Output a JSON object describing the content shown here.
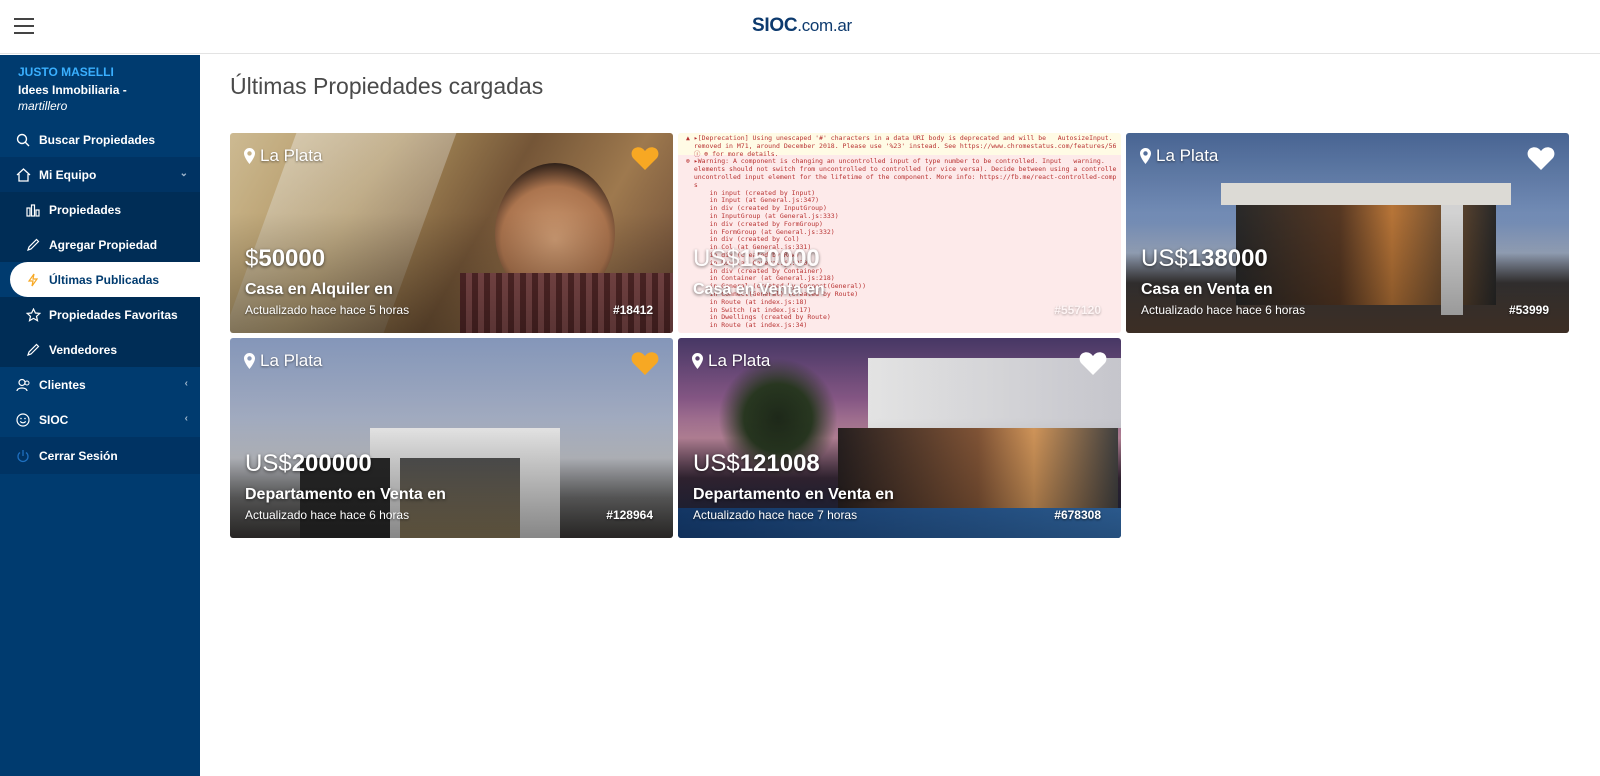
{
  "header": {
    "logo_bold": "SIOC",
    "logo_rest": ".com.ar"
  },
  "sidebar": {
    "user_name": "JUSTO MASELLI",
    "user_org": "Idees Inmobiliaria -",
    "user_role": "martillero",
    "items": [
      {
        "label": "Buscar Propiedades",
        "icon": "search-icon"
      },
      {
        "label": "Mi Equipo",
        "icon": "home-icon"
      },
      {
        "label": "Propiedades",
        "icon": "bar-chart-icon"
      },
      {
        "label": "Agregar Propiedad",
        "icon": "pencil-icon"
      },
      {
        "label": "Últimas Publicadas",
        "icon": "lightning-icon"
      },
      {
        "label": "Propiedades Favoritas",
        "icon": "star-icon"
      },
      {
        "label": "Vendedores",
        "icon": "pencil-icon"
      },
      {
        "label": "Clientes",
        "icon": "users-icon"
      },
      {
        "label": "SIOC",
        "icon": "smiley-icon"
      },
      {
        "label": "Cerrar Sesión",
        "icon": "power-icon"
      }
    ]
  },
  "main": {
    "title": "Últimas Propiedades cargadas"
  },
  "cards": [
    {
      "location": "La Plata",
      "currency": "$",
      "amount": "50000",
      "type": "Casa en Alquiler en",
      "updated": "Actualizado hace hace 5 horas",
      "code": "#18412",
      "favorite": true,
      "heart_color": "#f7a823"
    },
    {
      "location": "",
      "currency": "US$",
      "amount": "150000",
      "type": "Casa en Venta en",
      "updated": "",
      "code": "#557120",
      "favorite": false,
      "heart_color": "#ffffff"
    },
    {
      "location": "La Plata",
      "currency": "US$",
      "amount": "138000",
      "type": "Casa en Venta en",
      "updated": "Actualizado hace hace 6 horas",
      "code": "#53999",
      "favorite": false,
      "heart_color": "#ffffff"
    },
    {
      "location": "La Plata",
      "currency": "US$",
      "amount": "200000",
      "type": "Departamento en Venta en",
      "updated": "Actualizado hace hace 6 horas",
      "code": "#128964",
      "favorite": true,
      "heart_color": "#f7a823"
    },
    {
      "location": "La Plata",
      "currency": "US$",
      "amount": "121008",
      "type": "Departamento en Venta en",
      "updated": "Actualizado hace hace 7 horas",
      "code": "#678308",
      "favorite": false,
      "heart_color": "#ffffff"
    }
  ],
  "console_overlay": {
    "text": "▲ ▸[Deprecation] Using unescaped '#' characters in a data URI body is deprecated and will be   AutosizeInput.\n  removed in M71, around December 2018. Please use '%23' instead. See https://www.chromestatus.com/features/56\n  ⓘ ⊕ for more details.\n⊗ ▸Warning: A component is changing an uncontrolled input of type number to be controlled. Input   warning.\n  elements should not switch from uncontrolled to controlled (or vice versa). Decide between using a controlle\n  uncontrolled input element for the lifetime of the component. More info: https://fb.me/react-controlled-comp\n  s\n      in input (created by Input)\n      in Input (at General.js:347)\n      in div (created by InputGroup)\n      in InputGroup (at General.js:333)\n      in div (created by FormGroup)\n      in FormGroup (at General.js:332)\n      in div (created by Col)\n      in Col (at General.js:331)\n      in div (created by Row)\n      in Row (at General.js:230)\n      in div (created by Container)\n      in Container (at General.js:218)\n      in General (created by Connect(General))\n      in Connect(General) (created by Route)\n      in Route (at index.js:18)\n      in Switch (at index.js:17)\n      in Dwellings (created by Route)\n      in Route (at index.js:34)"
  },
  "colors": {
    "sidebar_bg": "#003b6f",
    "accent_blue": "#3ab0ff",
    "favorite": "#f7a823"
  }
}
